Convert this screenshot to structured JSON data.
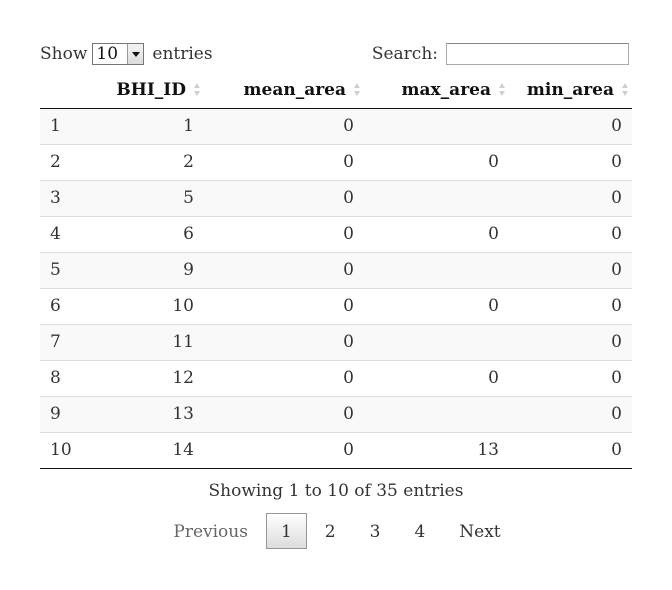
{
  "length": {
    "show_label": "Show",
    "selected": "10",
    "entries_label": "entries"
  },
  "search": {
    "label": "Search:",
    "value": "",
    "placeholder": ""
  },
  "table": {
    "columns": [
      "",
      "BHI_ID",
      "mean_area",
      "max_area",
      "min_area"
    ],
    "rows": [
      [
        "1",
        "1",
        "0",
        "",
        "0"
      ],
      [
        "2",
        "2",
        "0",
        "0",
        "0"
      ],
      [
        "3",
        "5",
        "0",
        "",
        "0"
      ],
      [
        "4",
        "6",
        "0",
        "0",
        "0"
      ],
      [
        "5",
        "9",
        "0",
        "",
        "0"
      ],
      [
        "6",
        "10",
        "0",
        "0",
        "0"
      ],
      [
        "7",
        "11",
        "0",
        "",
        "0"
      ],
      [
        "8",
        "12",
        "0",
        "0",
        "0"
      ],
      [
        "9",
        "13",
        "0",
        "",
        "0"
      ],
      [
        "10",
        "14",
        "0",
        "13",
        "0"
      ]
    ]
  },
  "info": "Showing 1 to 10 of 35 entries",
  "pagination": {
    "previous": "Previous",
    "pages": [
      "1",
      "2",
      "3",
      "4"
    ],
    "current_page": "1",
    "next": "Next"
  }
}
